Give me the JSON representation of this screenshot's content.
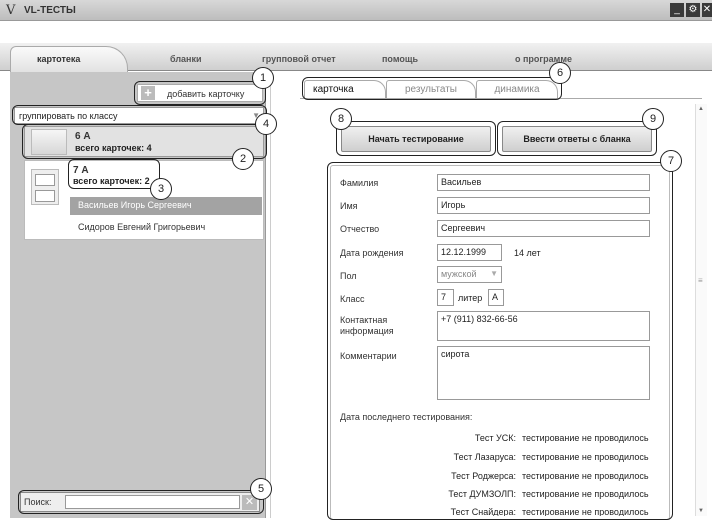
{
  "app": {
    "title": "VL-ТЕСТЫ",
    "logo": "V"
  },
  "window_controls": {
    "minimize": "_",
    "settings": "⚙",
    "close": "✕"
  },
  "nav": {
    "tabs": [
      "картотека",
      "бланки",
      "групповой отчет",
      "помощь",
      "о программе"
    ]
  },
  "sidebar": {
    "add_card": "добавить карточку",
    "group_select": "группировать по классу",
    "folders": [
      {
        "name": "6 А",
        "count": "всего карточек: 4"
      },
      {
        "name": "7 А",
        "count": "всего карточек: 2",
        "students": [
          "Васильев Игорь Сергеевич",
          "Сидоров Евгений Григорьевич"
        ]
      }
    ],
    "search_label": "Поиск:",
    "search_value": ""
  },
  "subtabs": [
    "карточка",
    "результаты",
    "динамика"
  ],
  "buttons": {
    "start": "Начать тестирование",
    "enter_answers": "Ввести ответы с бланка"
  },
  "form": {
    "labels": {
      "surname": "Фамилия",
      "name": "Имя",
      "patronymic": "Отчество",
      "dob": "Дата рождения",
      "gender": "Пол",
      "class": "Класс",
      "contact": "Контактная информация",
      "comments": "Комментарии"
    },
    "values": {
      "surname": "Васильев",
      "name": "Игорь",
      "patronymic": "Сергеевич",
      "dob": "12.12.1999",
      "age": "14 лет",
      "gender": "мужской",
      "class_num": "7",
      "liter_label": "литер",
      "liter": "А",
      "contact": "+7 (911) 832-66-56",
      "comments": "сирота"
    },
    "last_testing_title": "Дата последнего тестирования:",
    "tests": [
      {
        "name": "Тест УСК:",
        "status": "тестирование не проводилось"
      },
      {
        "name": "Тест Лазаруса:",
        "status": "тестирование не проводилось"
      },
      {
        "name": "Тест Роджерса:",
        "status": "тестирование не проводилось"
      },
      {
        "name": "Тест ДУМЗОЛП:",
        "status": "тестирование не проводилось"
      },
      {
        "name": "Тест Снайдера:",
        "status": "тестирование не проводилось"
      }
    ]
  },
  "callouts": [
    "1",
    "2",
    "3",
    "4",
    "5",
    "6",
    "7",
    "8",
    "9"
  ]
}
